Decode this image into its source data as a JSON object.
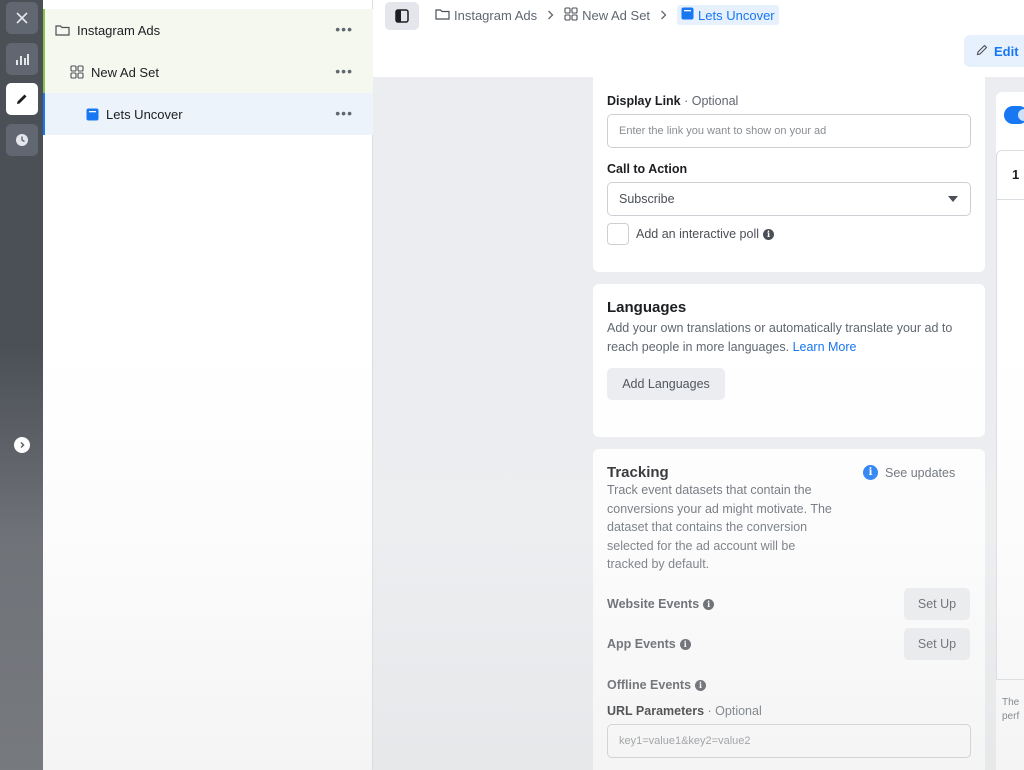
{
  "tree": {
    "campaign": {
      "label": "Instagram Ads"
    },
    "adset": {
      "label": "New Ad Set"
    },
    "ad": {
      "label": "Lets Uncover"
    },
    "more": "•••"
  },
  "breadcrumb": [
    {
      "label": "Instagram Ads"
    },
    {
      "label": "New Ad Set"
    },
    {
      "label": "Lets Uncover"
    }
  ],
  "header": {
    "edit_label": "Edit"
  },
  "display_link": {
    "label": "Display Link",
    "optional": "· Optional",
    "placeholder": "Enter the link you want to show on your ad"
  },
  "call_to_action": {
    "label": "Call to Action",
    "selected": "Subscribe"
  },
  "poll": {
    "label": "Add an interactive poll"
  },
  "languages": {
    "title": "Languages",
    "desc_line1": "Add your own translations or automatically translate your ad to",
    "desc_line2": "reach people in more languages.",
    "learn_more": "Learn More",
    "button": "Add Languages"
  },
  "tracking": {
    "title": "Tracking",
    "see_updates": "See updates",
    "desc": [
      "Track event datasets that contain the",
      "conversions your ad might motivate. The",
      "dataset that contains the conversion",
      "selected for the ad account will be",
      "tracked by default."
    ],
    "website_events": "Website Events",
    "app_events": "App Events",
    "offline_events": "Offline Events",
    "setup": "Set Up",
    "url_params_label": "URL Parameters",
    "url_params_optional": "· Optional",
    "url_params_placeholder": "key1=value1&key2=value2"
  },
  "preview": {
    "number": "1",
    "foot_line1": "The",
    "foot_line2": "perf"
  },
  "colors": {
    "accent": "#1877f2",
    "rail": "#4b4f56",
    "tree_green": "#8bc34a"
  }
}
